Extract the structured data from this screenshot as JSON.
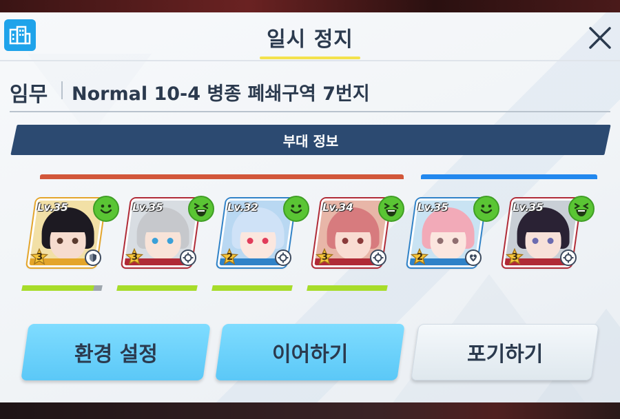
{
  "header": {
    "icon": "building-icon",
    "title": "일시 정지",
    "close_icon": "close-icon"
  },
  "mission": {
    "label": "임무",
    "name": "Normal 10-4 병종 폐쇄구역 7번지"
  },
  "squad": {
    "title": "부대 정보",
    "striker_color": "#d2573a",
    "special_color": "#2288ee",
    "members": [
      {
        "level": "Lv.35",
        "star": "3",
        "role_icon": "shield-icon",
        "mood_icon": "smile-face-icon",
        "hp": 0.9,
        "hair": "#1d1a22",
        "skin": "#f6dccf",
        "eye": "#5a3a2e",
        "frame": "#e4a52a",
        "bg": "#f2e0a6"
      },
      {
        "level": "Lv.35",
        "star": "3",
        "role_icon": "crosshair-icon",
        "mood_icon": "laugh-face-icon",
        "hp": 1.0,
        "hair": "#c6c8cc",
        "skin": "#f8e3d8",
        "eye": "#3aa0d8",
        "frame": "#b02a36",
        "bg": "#d8dde2"
      },
      {
        "level": "Lv.32",
        "star": "2",
        "role_icon": "crosshair-icon",
        "mood_icon": "smile-face-icon",
        "hp": 1.0,
        "hair": "#cfe2f7",
        "skin": "#fbe7df",
        "eye": "#e13c5a",
        "frame": "#2f82c8",
        "bg": "#b9d8f2"
      },
      {
        "level": "Lv.34",
        "star": "3",
        "role_icon": "crosshair-icon",
        "mood_icon": "laugh-face-icon",
        "hp": 1.0,
        "hair": "#d77b7e",
        "skin": "#f9dcd2",
        "eye": "#8a3a3a",
        "frame": "#b02a36",
        "bg": "#e8b6a8"
      },
      {
        "level": "Lv.35",
        "star": "2",
        "role_icon": "heal-icon",
        "mood_icon": "smile-face-icon",
        "hp": null,
        "hair": "#f2aab8",
        "skin": "#fbe6df",
        "eye": "#8f6e70",
        "frame": "#2f82c8",
        "bg": "#c9e3f3"
      },
      {
        "level": "Lv.35",
        "star": "3",
        "role_icon": "crosshair-icon",
        "mood_icon": "laugh-face-icon",
        "hp": null,
        "hair": "#2a2234",
        "skin": "#f7e1d9",
        "eye": "#6b6bb0",
        "frame": "#b02a36",
        "bg": "#c9cfd6"
      }
    ]
  },
  "buttons": {
    "settings": "환경 설정",
    "continue": "이어하기",
    "give_up": "포기하기"
  }
}
